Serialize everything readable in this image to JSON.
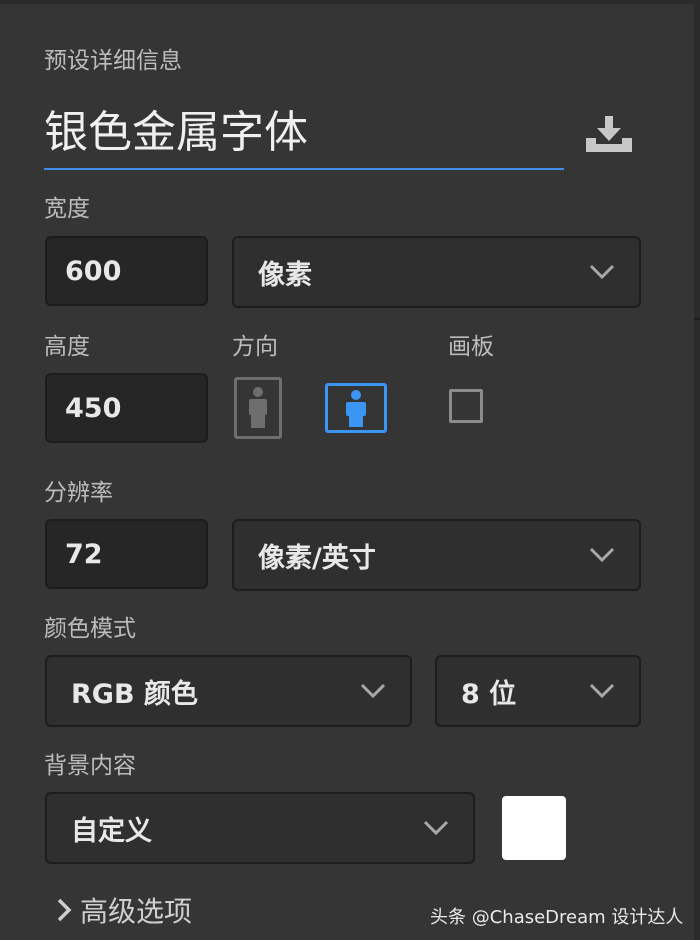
{
  "panel": {
    "section_title": "预设详细信息",
    "preset_name": "银色金属字体",
    "save_icon": "save-preset-icon"
  },
  "width": {
    "label": "宽度",
    "value": "600",
    "unit": "像素"
  },
  "height": {
    "label": "高度",
    "value": "450"
  },
  "orientation": {
    "label": "方向",
    "selected": "landscape"
  },
  "artboard": {
    "label": "画板",
    "checked": false
  },
  "resolution": {
    "label": "分辨率",
    "value": "72",
    "unit": "像素/英寸"
  },
  "color_mode": {
    "label": "颜色模式",
    "mode": "RGB 颜色",
    "depth": "8 位"
  },
  "background": {
    "label": "背景内容",
    "value": "自定义",
    "swatch_color": "#ffffff"
  },
  "advanced": {
    "label": "高级选项"
  },
  "watermark": {
    "text": "头条 @ChaseDream 设计达人"
  },
  "colors": {
    "accent": "#3c8ee8",
    "panel_bg": "#353535",
    "field_bg": "#262626"
  }
}
